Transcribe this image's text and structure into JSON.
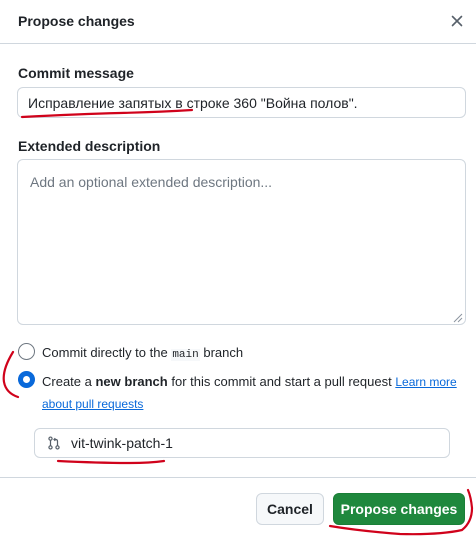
{
  "dialog": {
    "title": "Propose changes",
    "close_icon": "close-icon"
  },
  "commit": {
    "label": "Commit message",
    "value": "Исправление запятых в строке 360 \"Война полов\"."
  },
  "extended": {
    "label": "Extended description",
    "placeholder": "Add an optional extended description..."
  },
  "options": {
    "direct_prefix": "Commit directly to the ",
    "direct_branch": "main",
    "direct_suffix": " branch",
    "direct_checked": false,
    "new_prefix": "Create a ",
    "new_bold": "new branch",
    "new_suffix": " for this commit and start a pull request ",
    "new_link": "Learn more about pull requests",
    "new_checked": true
  },
  "branch": {
    "icon": "git-pull-request-icon",
    "name": "vit-twink-patch-1"
  },
  "buttons": {
    "cancel": "Cancel",
    "propose": "Propose changes"
  },
  "colors": {
    "primary_button": "#1f883d",
    "link": "#0969da",
    "annotation": "#d0021b"
  }
}
